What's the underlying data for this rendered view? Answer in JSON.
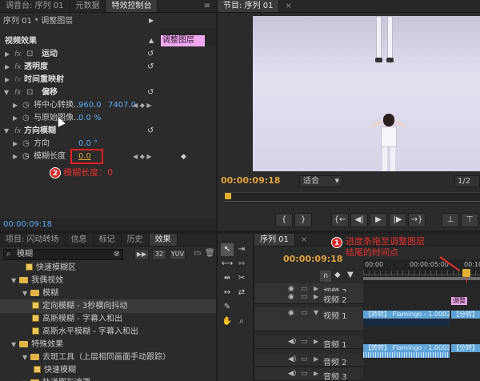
{
  "top_left_tabs": [
    "调音台: 序列 01",
    "元数据",
    "特效控制台"
  ],
  "ec": {
    "header": "序列 01 * 调整图层",
    "clip_label": "调整图层",
    "video_effects": "视频效果",
    "motion": "运动",
    "opacity": "透明度",
    "time_remap": "时间重映射",
    "offset": "偏移",
    "shift_center": "将中心转换...",
    "shift_x": "960.0",
    "shift_y": "7407.0",
    "blend": "与原始图像...",
    "blend_val": "0.0 %",
    "dir_blur": "方向模糊",
    "direction": "方向",
    "direction_val": "0.0 °",
    "blur_len": "模糊长度",
    "blur_val": "0.0",
    "annotation2": "模糊长度：0",
    "time": "00:00:09:18"
  },
  "monitor": {
    "tab": "节目: 序列 01",
    "time": "00:00:09:18",
    "fit": "适合",
    "ratio": "1/2"
  },
  "project_tabs": [
    "项目: 闪动转场",
    "信息",
    "标记",
    "历史",
    "效果"
  ],
  "effects": {
    "search": "模糊",
    "items": [
      {
        "label": "快速模糊区",
        "indent": 32,
        "kind": "fx"
      },
      {
        "label": "我偶视效",
        "indent": 14,
        "kind": "folder"
      },
      {
        "label": "模糊",
        "indent": 28,
        "kind": "folder"
      },
      {
        "label": "定向模糊 - 3秒横向抖动",
        "indent": 40,
        "kind": "fx"
      },
      {
        "label": "高斯模糊 - 字幕入和出",
        "indent": 40,
        "kind": "fx"
      },
      {
        "label": "高斯水平模糊 - 字幕入和出",
        "indent": 40,
        "kind": "fx"
      },
      {
        "label": "特殊效果",
        "indent": 14,
        "kind": "folder"
      },
      {
        "label": "去斑工具（上层相同画面手动跟踪）",
        "indent": 28,
        "kind": "folder"
      },
      {
        "label": "快速模糊",
        "indent": 42,
        "kind": "fx"
      },
      {
        "label": "轨道图形遮罩",
        "indent": 28,
        "kind": "folder"
      }
    ]
  },
  "timeline": {
    "tab": "序列 01",
    "time": "00:00:09:18",
    "ruler": [
      "00:00",
      "00:00:05:00",
      "00:10"
    ],
    "annotation1": "进度条拖至调整图层",
    "annotation1b": "结尾的时间点",
    "tracks": [
      {
        "name": "视频 3"
      },
      {
        "name": "视频 2"
      },
      {
        "name": "视频 1"
      },
      {
        "name": "音频 1"
      },
      {
        "name": "音频 2"
      },
      {
        "name": "音频 3"
      }
    ],
    "clip_v2": "调整",
    "clip_v1": "【转转】 Flamingo - 1.00027",
    "clip_v1b": "【分转】",
    "clip_a1": "【转转】 Flamingo - 1.00027",
    "clip_a1b": "【分转】"
  },
  "colors": {
    "accent_blue": "#5fa8ee",
    "annotation_red": "#e23030",
    "timecode_orange": "#e0a23a"
  }
}
